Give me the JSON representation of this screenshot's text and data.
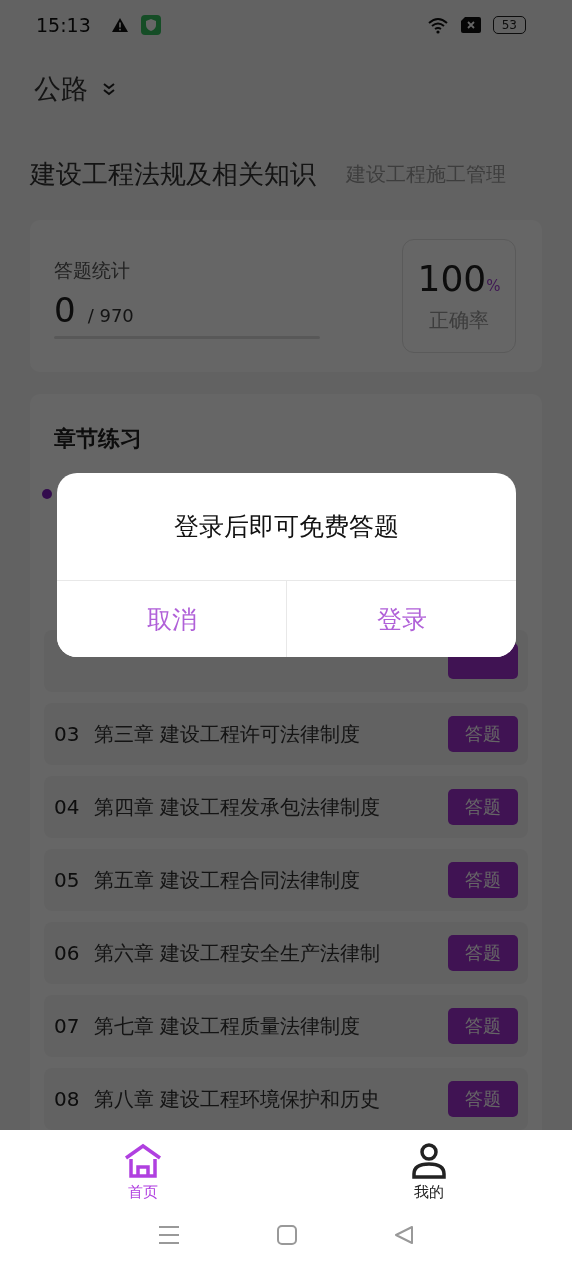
{
  "status_bar": {
    "time": "15:13",
    "battery": "53"
  },
  "header": {
    "title": "公路"
  },
  "subjects": [
    {
      "label": "建设工程法规及相关知识",
      "selected": true
    },
    {
      "label": "建设工程施工管理",
      "selected": false
    }
  ],
  "stats": {
    "label": "答题统计",
    "answered": "0",
    "total": "/ 970",
    "level": 0,
    "accuracy": "100",
    "unit": "%",
    "accuracy_label": "正确率"
  },
  "chapters": {
    "title": "章节练习",
    "rows": [
      {
        "number": "03",
        "title": "第三章 建设工程许可法律制度",
        "action": "答题"
      },
      {
        "number": "04",
        "title": "第四章 建设工程发承包法律制度",
        "action": "答题"
      },
      {
        "number": "05",
        "title": "第五章 建设工程合同法律制度",
        "action": "答题"
      },
      {
        "number": "06",
        "title": "第六章 建设工程安全生产法律制",
        "action": "答题"
      },
      {
        "number": "07",
        "title": "第七章 建设工程质量法律制度",
        "action": "答题"
      },
      {
        "number": "08",
        "title": "第八章 建设工程环境保护和历史",
        "action": "答题"
      }
    ]
  },
  "dialog": {
    "message": "登录后即可免费答题",
    "buttons": [
      "取消",
      "登录"
    ]
  },
  "tab_bar": [
    {
      "label": "首页",
      "kind": "home",
      "selected": true
    },
    {
      "label": "我的",
      "kind": "profile",
      "selected": false
    }
  ]
}
